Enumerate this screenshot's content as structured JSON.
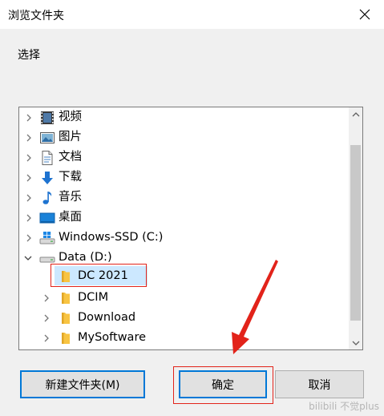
{
  "window": {
    "title": "浏览文件夹",
    "close_glyph": "✕"
  },
  "instruction": "选择",
  "tree": {
    "items": [
      {
        "label": "视频",
        "icon": "video-icon"
      },
      {
        "label": "图片",
        "icon": "pictures-icon"
      },
      {
        "label": "文档",
        "icon": "documents-icon"
      },
      {
        "label": "下载",
        "icon": "downloads-icon"
      },
      {
        "label": "音乐",
        "icon": "music-icon"
      },
      {
        "label": "桌面",
        "icon": "desktop-icon"
      },
      {
        "label": "Windows-SSD (C:)",
        "icon": "drive-c-icon"
      },
      {
        "label": "Data (D:)",
        "icon": "drive-d-icon",
        "expanded": true
      },
      {
        "label": "DC 2021",
        "icon": "folder-icon",
        "selected": true
      },
      {
        "label": "DCIM",
        "icon": "folder-icon"
      },
      {
        "label": "Download",
        "icon": "folder-icon"
      },
      {
        "label": "MySoftware",
        "icon": "folder-icon"
      }
    ]
  },
  "buttons": {
    "new_folder": "新建文件夹(M)",
    "ok": "确定",
    "cancel": "取消"
  },
  "watermark": "bilibili 不觉plus",
  "colors": {
    "accent": "#0078d7",
    "selection": "#cce8ff",
    "annotation": "#e2231a",
    "folder": "#f8c442"
  }
}
